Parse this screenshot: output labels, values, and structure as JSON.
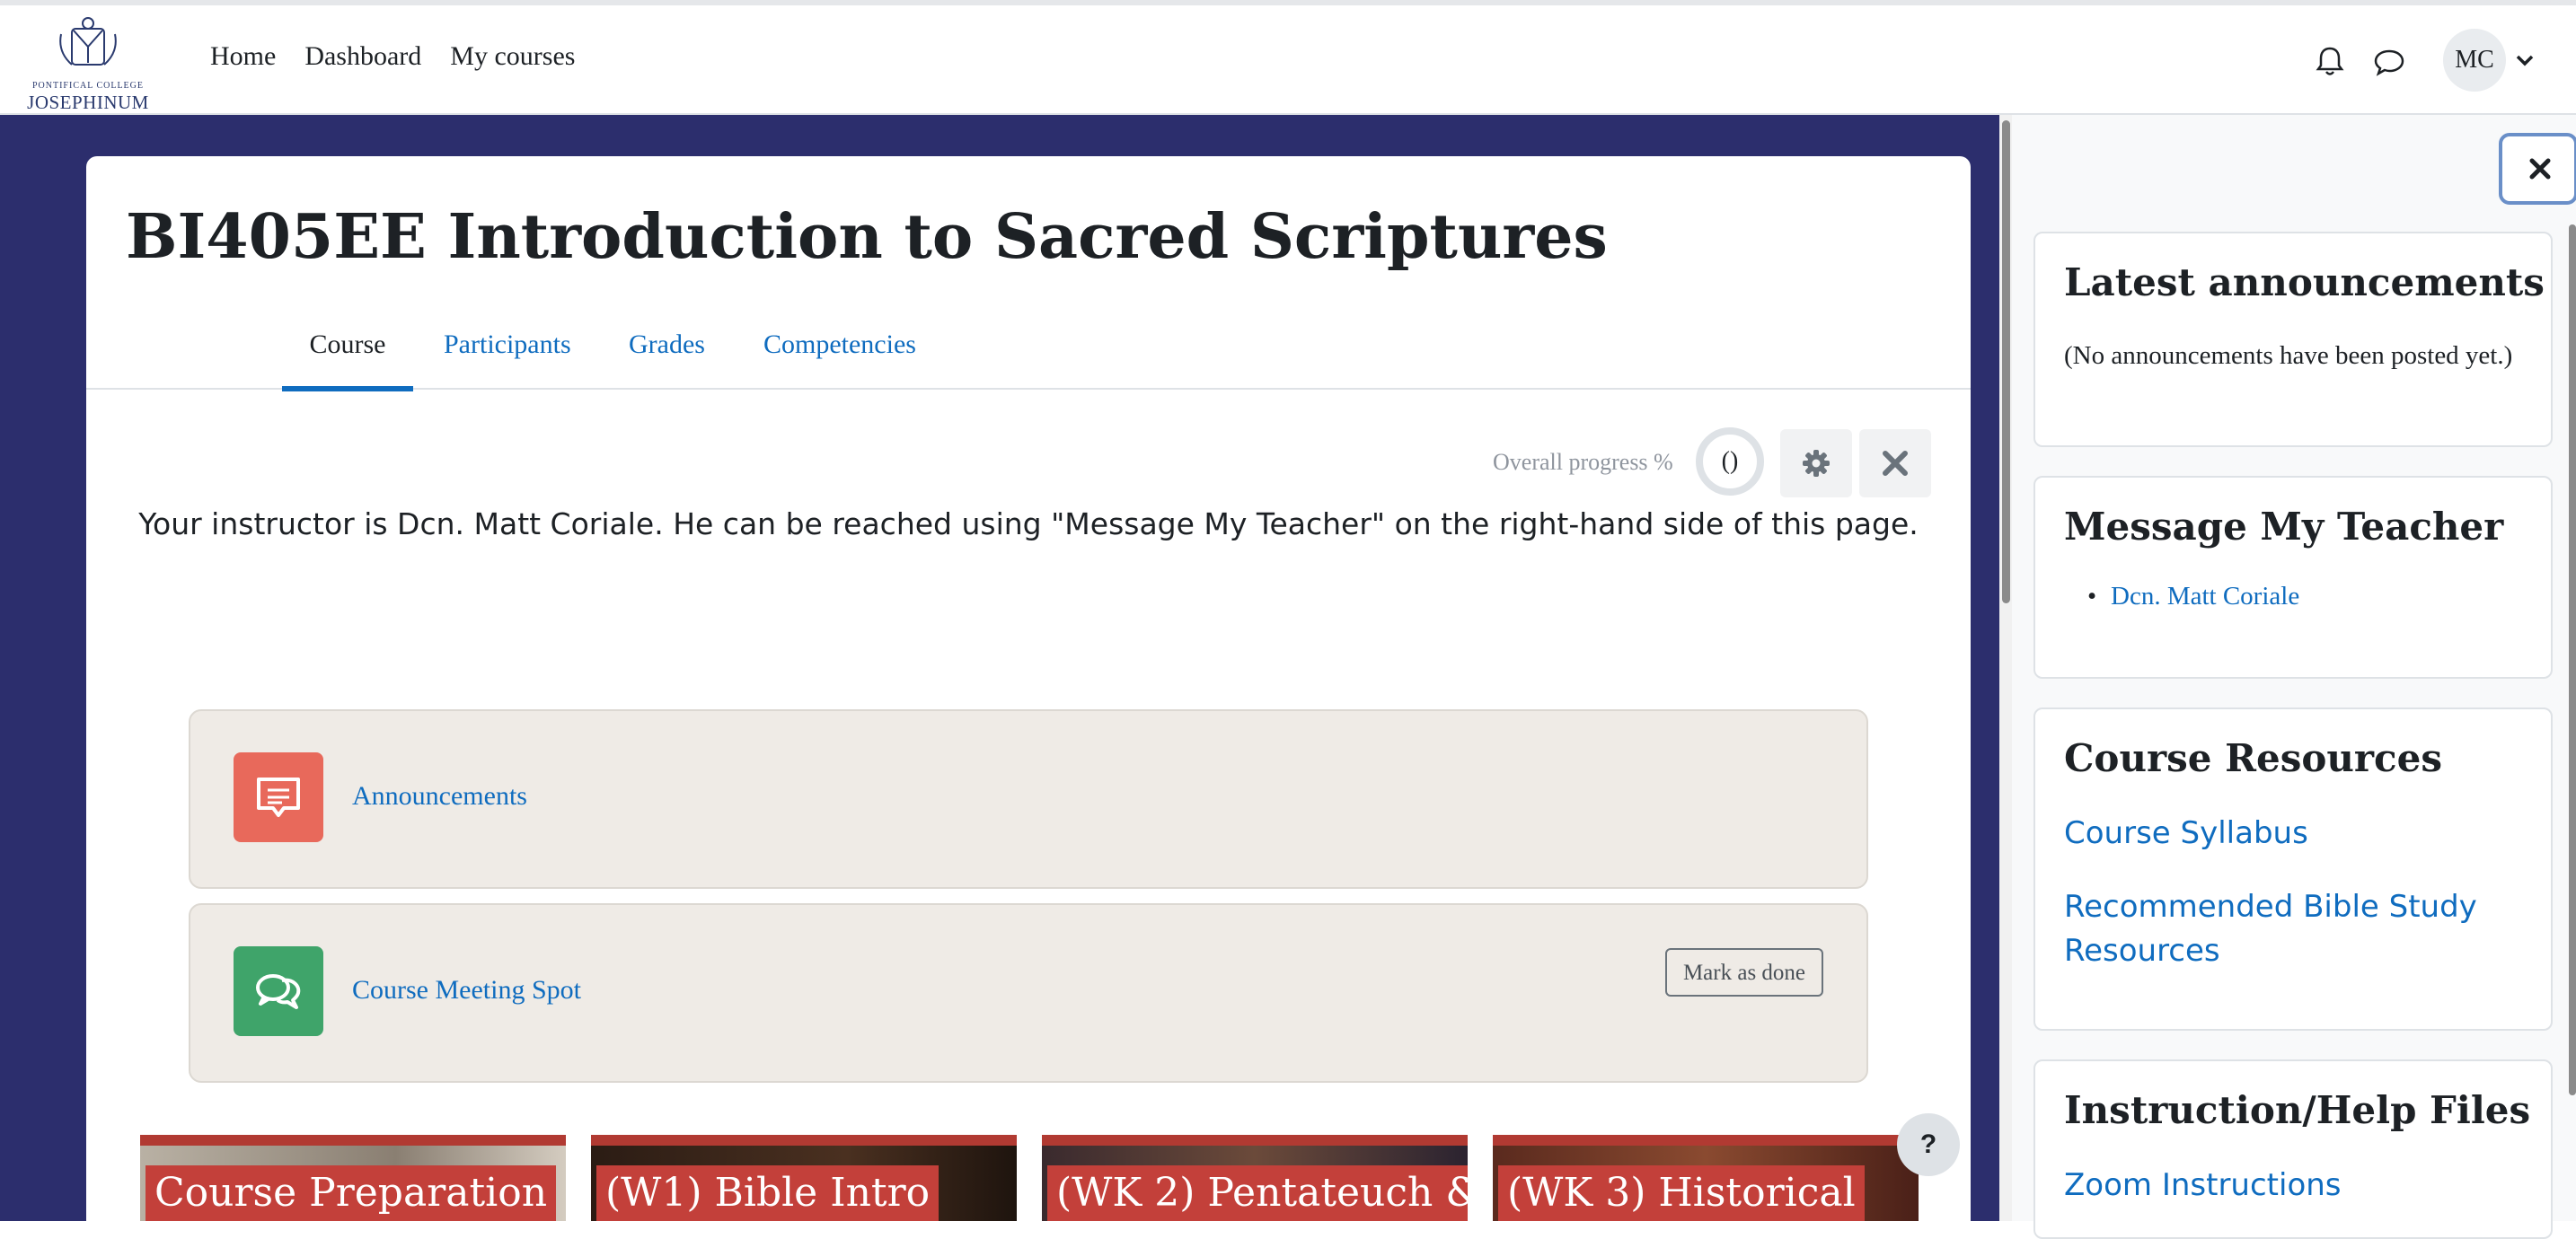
{
  "navbar": {
    "logo_line1": "PONTIFICAL COLLEGE",
    "logo_line2": "JOSEPHINUM",
    "links": [
      "Home",
      "Dashboard",
      "My courses"
    ],
    "user_initials": "MC"
  },
  "course": {
    "title": "BI405EE Introduction to Sacred Scriptures",
    "tabs": [
      "Course",
      "Participants",
      "Grades",
      "Competencies"
    ],
    "active_tab": "Course",
    "progress_label": "Overall progress %",
    "progress_value": "()",
    "instructor_text": "Your instructor is Dcn. Matt Coriale.  He can be reached using \"Message My Teacher\" on the right-hand side of this page.",
    "activities": [
      {
        "name": "Announcements",
        "icon": "announcement-icon",
        "color": "#e8695b"
      },
      {
        "name": "Course Meeting Spot",
        "icon": "forum-icon",
        "color": "#3fa46a",
        "button": "Mark as done"
      }
    ],
    "tiles": [
      "Course Preparation",
      "(W1) Bible Intro",
      "(WK 2) Pentateuch &",
      "(WK 3) Historical"
    ]
  },
  "drawer": {
    "blocks": {
      "announcements": {
        "title": "Latest announcements",
        "text": "(No announcements have been posted yet.)"
      },
      "message_teacher": {
        "title": "Message My Teacher",
        "teacher": "Dcn. Matt Coriale"
      },
      "resources": {
        "title": "Course Resources",
        "links": [
          "Course Syllabus",
          "Recommended Bible Study Resources"
        ]
      },
      "help": {
        "title": "Instruction/Help Files",
        "links": [
          "Zoom Instructions"
        ]
      }
    }
  },
  "help_button": "?",
  "colors": {
    "page_bg": "#2c2e6d",
    "link": "#0f6cbf",
    "tile": "#c3403a"
  }
}
